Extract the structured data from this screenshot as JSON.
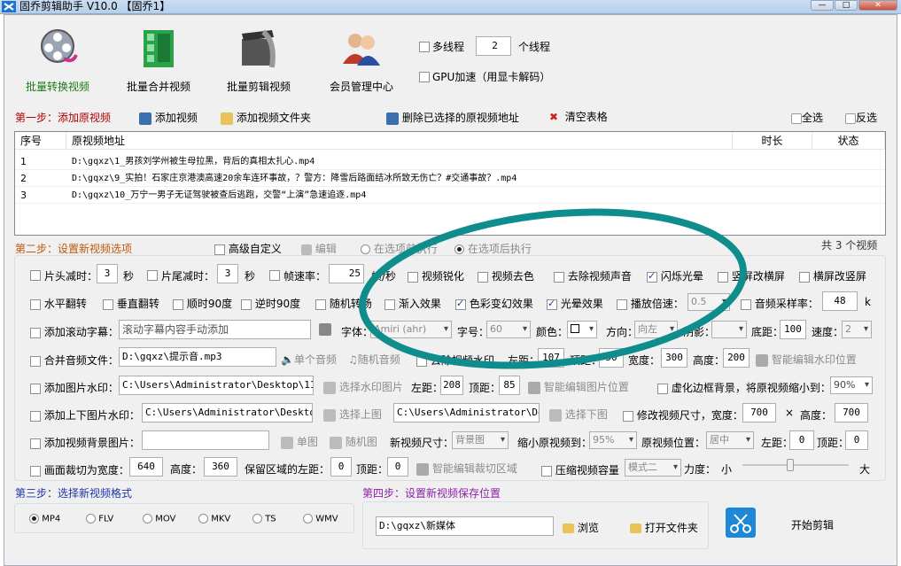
{
  "title": "固乔剪辑助手 V10.0 【固乔1】",
  "toolbar": [
    {
      "label": "批量转换视频",
      "icon": "film-reel-icon",
      "active": true
    },
    {
      "label": "批量合并视频",
      "icon": "film-strip-icon"
    },
    {
      "label": "批量剪辑视频",
      "icon": "clapper-film-icon"
    },
    {
      "label": "会员管理中心",
      "icon": "users-icon"
    }
  ],
  "options": {
    "multithread": "多线程",
    "threads": "2",
    "threads_suffix": "个线程",
    "gpu": "GPU加速（用显卡解码）"
  },
  "step1": {
    "label": "第一步：添加原视频",
    "add_video": "添加视频",
    "add_folder": "添加视频文件夹",
    "delete_selected": "删除已选择的原视频地址",
    "clear": "清空表格",
    "select_all": "全选",
    "invert": "反选"
  },
  "table": {
    "headers": [
      "序号",
      "原视频地址",
      "时长",
      "状态"
    ],
    "rows": [
      {
        "no": "1",
        "path": "D:\\gqxz\\1_男孩刘学州被生母拉黑，背后的真相太扎心.mp4",
        "dur": "",
        "status": ""
      },
      {
        "no": "2",
        "path": "D:\\gqxz\\9_实拍！石家庄京港澳高速20余车连环事故，？警方：降雪后路面结冰所致无伤亡？#交通事故？.mp4",
        "dur": "",
        "status": ""
      },
      {
        "no": "3",
        "path": "D:\\gqxz\\10_万宁一男子无证驾驶被查后逃跑，交警“上演”急速追逐.mp4",
        "dur": "",
        "status": ""
      }
    ]
  },
  "step2": {
    "label": "第二步：设置新视频选项",
    "advanced": "高级自定义",
    "edit": "编辑",
    "before": "在选项前执行",
    "after": "在选项后执行",
    "count": "共 3 个视频"
  },
  "r1": {
    "head_cut": "片头减时：",
    "head_val": "3",
    "sec1": "秒",
    "tail_cut": "片尾减时：",
    "tail_val": "3",
    "sec2": "秒",
    "fps": "帧速率：",
    "fps_val": "25",
    "fps_unit": "帧/秒",
    "sharpen": "视频锐化",
    "decolor": "视频去色",
    "mute": "去除视频声音",
    "flash": "闪烁光晕",
    "v2h": "竖屏改横屏",
    "h2v": "横屏改竖屏"
  },
  "r2": {
    "hflip": "水平翻转",
    "vflip": "垂直翻转",
    "cw90": "顺时90度",
    "ccw90": "逆时90度",
    "random": "随机转场",
    "fadein": "渐入效果",
    "color": "色彩变幻效果",
    "halo": "光晕效果",
    "speed": "播放倍速：",
    "speed_val": "0.5",
    "sample": "音频采样率：",
    "sample_val": "48",
    "sample_unit": "k"
  },
  "r3": {
    "subtitle": "添加滚动字幕：",
    "subtitle_val": "滚动字幕内容手动添加",
    "font": "字体：",
    "font_val": "Amiri (ahr)",
    "size": "字号：",
    "size_val": "60",
    "color": "颜色：",
    "dir": "方向：",
    "dir_val": "向左",
    "shadow": "阴影：",
    "shadow_val": "",
    "bottom": "底距：",
    "bottom_val": "100",
    "spd": "速度：",
    "spd_val": "2"
  },
  "r4": {
    "audio": "合并音频文件：",
    "audio_val": "D:\\gqxz\\提示音.mp3",
    "single": "单个音频",
    "rand": "随机音频",
    "remove_wm": "去除视频水印",
    "left": "左距：",
    "left_val": "107",
    "top": "顶距：",
    "top_val": "50",
    "width": "宽度：",
    "width_val": "300",
    "height": "高度：",
    "height_val": "200",
    "smart_wm": "智能编辑水印位置"
  },
  "r5": {
    "pic_wm": "添加图片水印：",
    "pic_val": "C:\\Users\\Administrator\\Desktop\\111.j",
    "choose": "选择水印图片",
    "left": "左距：",
    "left_val": "208",
    "top": "顶距：",
    "top_val": "85",
    "smart": "智能编辑图片位置",
    "blur": "虚化边框背景，将原视频缩小到：",
    "blur_val": "90%"
  },
  "r6": {
    "tb": "添加上下图片水印：",
    "path1": "C:\\Users\\Administrator\\Desktop\\i",
    "up": "选择上图",
    "path2": "C:\\Users\\Administrator\\Desk",
    "down": "选择下图",
    "resize": "修改视频尺寸，宽度：",
    "w": "700",
    "x": "×",
    "h_label": "高度：",
    "h": "700"
  },
  "r7": {
    "bg": "添加视频背景图片：",
    "single": "单图",
    "rand": "随机图",
    "newsize": "新视频尺寸：",
    "newsize_val": "背景图",
    "shrink": "缩小原视频到：",
    "shrink_val": "95%",
    "pos": "原视频位置：",
    "pos_val": "居中",
    "left": "左距：",
    "left_val": "0",
    "top": "顶距：",
    "top_val": "0"
  },
  "r8": {
    "crop": "画面裁切为宽度：",
    "w": "640",
    "h_label": "高度：",
    "h": "360",
    "keep": "保留区域的左距：",
    "left": "0",
    "top_label": "顶距：",
    "top": "0",
    "smart": "智能编辑裁切区域",
    "compress": "压缩视频容量",
    "mode": "模式二",
    "strength": "力度：",
    "small": "小",
    "large": "大",
    "level": 0.45
  },
  "step3": {
    "label": "第三步：选择新视频格式",
    "formats": [
      "MP4",
      "FLV",
      "MOV",
      "MKV",
      "TS",
      "WMV"
    ]
  },
  "step4": {
    "label": "第四步：设置新视频保存位置",
    "path": "D:\\gqxz\\新媒体",
    "browse": "浏览",
    "open": "打开文件夹",
    "start": "开始剪辑"
  },
  "colors": {
    "accent_red": "#b00000",
    "purple": "#8d1fa6",
    "blue": "#1d35a8",
    "teal_ring": "#0f8d8d"
  }
}
